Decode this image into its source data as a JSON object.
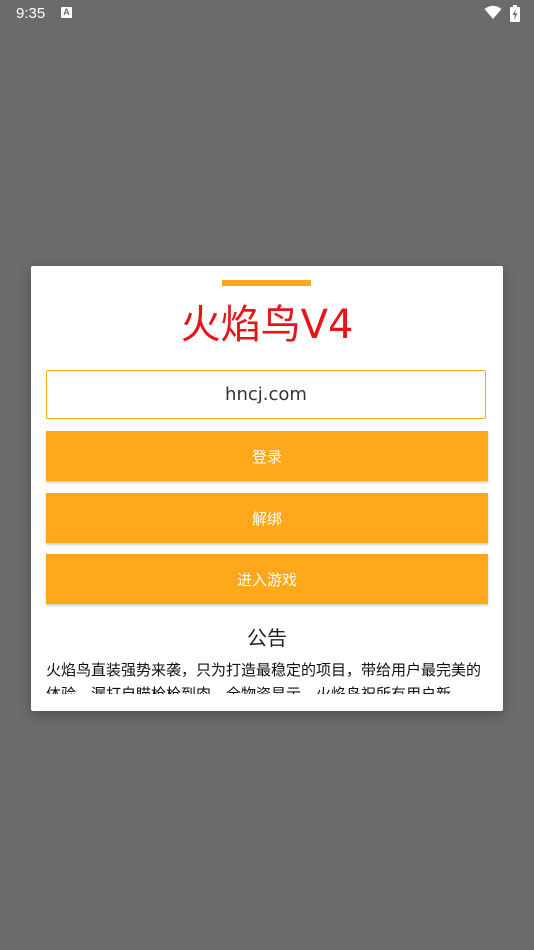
{
  "status_bar": {
    "time": "9:35"
  },
  "dialog": {
    "title": "火焰鸟V4",
    "input_value": "hncj.com",
    "buttons": {
      "login": "登录",
      "unbind": "解绑",
      "enter_game": "进入游戏"
    },
    "notice_title": "公告",
    "notice_body": "火焰鸟直装强势来袭，只为打造最稳定的项目，带给用户最完美的体验。漏打自瞄枪枪到肉，全物资显示，火焰鸟祝所有用户新"
  },
  "colors": {
    "accent": "#FFA81C",
    "title_red": "#E5151A",
    "overlay": "#6b6b6b"
  }
}
